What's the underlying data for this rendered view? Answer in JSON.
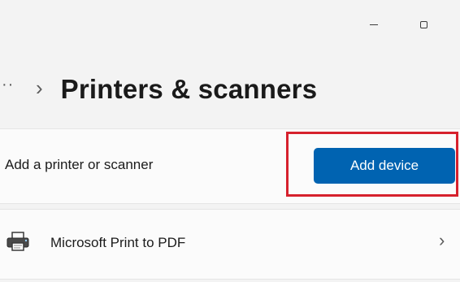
{
  "window": {
    "minimize_glyph": "–",
    "maximize_glyph": "▢"
  },
  "breadcrumb": {
    "more": "··",
    "separator": "›",
    "title": "Printers & scanners"
  },
  "add_section": {
    "label": "Add a printer or scanner",
    "button_label": "Add device",
    "button_color": "#0063b1",
    "highlight_color": "#d6212d"
  },
  "devices": [
    {
      "name": "Microsoft Print to PDF",
      "icon": "printer-icon",
      "chevron": "›"
    }
  ]
}
